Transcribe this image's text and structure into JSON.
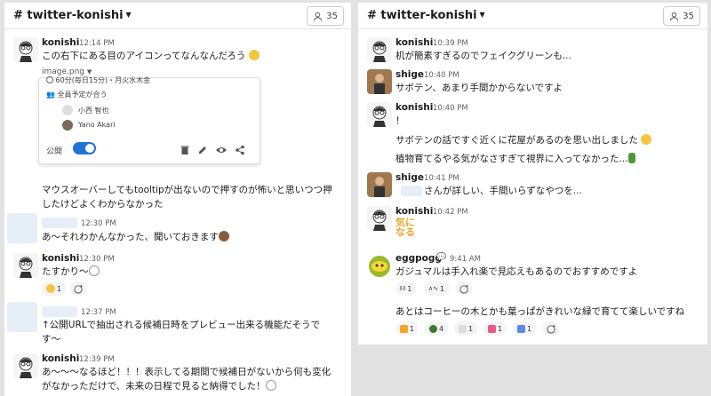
{
  "left": {
    "channel": "# twitter-konishi",
    "members": "35",
    "messages": [
      {
        "name": "konishi",
        "time": "12:14 PM",
        "text": "この右下にある目のアイコンってなんなんだろう"
      },
      {
        "file": "image.png",
        "card": {
          "duration": "60分(毎日15分)・月火水木金",
          "attendance": "全員予定が合う",
          "attendee1": "小西 智也",
          "attendee2": "Yano Akari",
          "public_label": "公開"
        }
      },
      {
        "text1": "マウスオーバーしてもtooltipが出ないので押すのが怖いと思いつつ押",
        "text2": "したけどよくわからなかった"
      },
      {
        "time": "12:30 PM",
        "text": "あ〜それわかんなかった、聞いておきます"
      },
      {
        "name": "konishi",
        "time": "12:30 PM",
        "text": "たすかり〜",
        "reaction_count": "1"
      },
      {
        "time": "12:37 PM",
        "text1": "↑公開URLで抽出される候補日時をプレビュー出来る機能だそうで",
        "text2": "す〜"
      },
      {
        "name": "konishi",
        "time": "12:39 PM",
        "text1": "あ〜〜〜なるほど！！！表示してる期間で候補日がないから何も変化",
        "text2": "がなかっただけで、未来の日程で見ると納得でした！"
      }
    ]
  },
  "right": {
    "channel": "# twitter-konishi",
    "members": "35",
    "messages": [
      {
        "name": "konishi",
        "time": "10:39 PM",
        "text": "机が簡素すぎるのでフェイクグリーンも..."
      },
      {
        "name": "shige",
        "time": "10:40 PM",
        "text": "サボテン、あまり手間かからないですよ"
      },
      {
        "name": "konishi",
        "time": "10:40 PM",
        "text1": "！",
        "text2": "サボテンの話ですぐ近くに花屋があるのを思い出しました",
        "text3": "植物育てるやる気がなさすぎて視界に入ってなかった..."
      },
      {
        "name": "shige",
        "time": "10:41 PM",
        "text": "さんが詳しい、手間いらずなやつを..."
      },
      {
        "name": "konishi",
        "time": "10:42 PM",
        "stamp1": "気に",
        "stamp2": "なる"
      },
      {
        "name": "eggpogg",
        "time": "9:41 AM",
        "text1": "ガジュマルは手入れ楽で見応えもあるのでおすすめですよ",
        "r1": "1",
        "r2": "1",
        "text2": "あとはコーヒーの木とかも葉っぱがきれいな緑で育てて楽しいですね",
        "r3": "1",
        "r4": "4",
        "r5": "1",
        "r6": "1",
        "r7": "1"
      }
    ]
  },
  "colors": {
    "toggle": "#1f73d8",
    "stamp": "#f1a62a",
    "link": "#1d9bd1"
  }
}
